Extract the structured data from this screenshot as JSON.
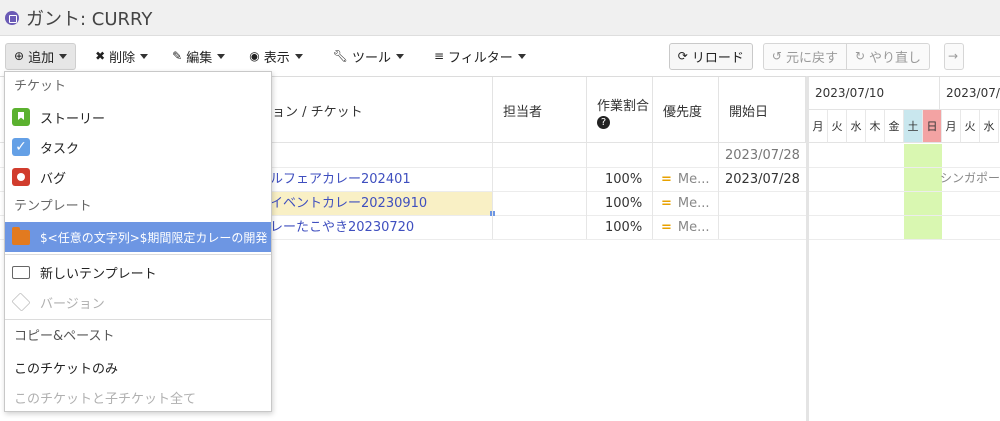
{
  "title": "ガント: CURRY",
  "toolbar": {
    "add": "追加",
    "delete": "削除",
    "edit": "編集",
    "view": "表示",
    "tools": "ツール",
    "filter": "フィルター",
    "reload": "リロード",
    "undo": "元に戻す",
    "redo": "やり直し"
  },
  "columns": {
    "name": "ョン / チケット",
    "assignee": "担当者",
    "done_ratio": "作業割合",
    "priority": "優先度",
    "start_date": "開始日"
  },
  "rows": [
    {
      "name": "",
      "done": "",
      "priority": "",
      "start": "2023/07/28"
    },
    {
      "name": "ルフェアカレー202401",
      "done": "100%",
      "priority": "Me...",
      "start": "2023/07/28"
    },
    {
      "name": "イベントカレー20230910",
      "done": "100%",
      "priority": "Me...",
      "start": ""
    },
    {
      "name": "レーたこやき20230720",
      "done": "100%",
      "priority": "Me...",
      "start": ""
    }
  ],
  "gantt": {
    "weeks": [
      "2023/07/10",
      "2023/07/1"
    ],
    "days": [
      "月",
      "火",
      "水",
      "木",
      "金",
      "土",
      "日",
      "月",
      "火",
      "水"
    ],
    "bar_label": "シンガポール"
  },
  "menu": {
    "ticket_header": "チケット",
    "story": "ストーリー",
    "task": "タスク",
    "bug": "バグ",
    "template_header": "テンプレート",
    "template_item": "$<任意の文字列>$期間限定カレーの開発",
    "new_template": "新しいテンプレート",
    "version": "バージョン",
    "copy_paste_header": "コピー&ペースト",
    "this_ticket": "このチケットのみ",
    "this_and_children": "このチケットと子チケット全て"
  },
  "colors": {
    "accent": "#6d96e3",
    "link": "#3f4fbf",
    "weekend_sat": "#c9e7ee",
    "weekend_sun": "#f3a3a3",
    "gantt_highlight": "#d9f7b1"
  }
}
